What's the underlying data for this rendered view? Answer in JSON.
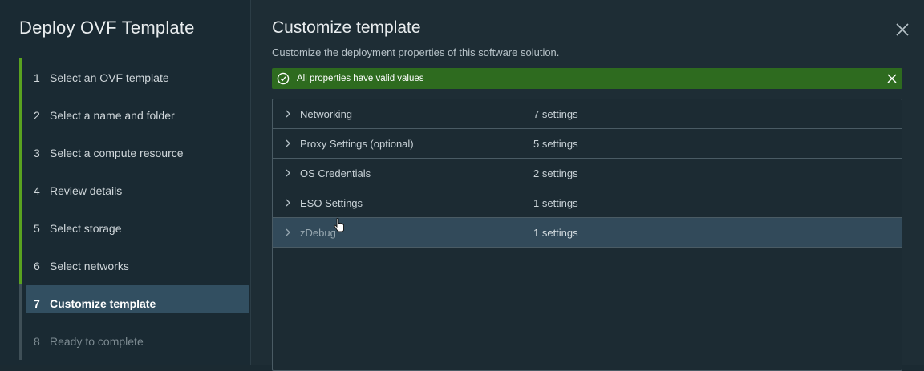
{
  "wizard": {
    "title": "Deploy OVF Template",
    "steps": [
      {
        "num": "1",
        "label": "Select an OVF template"
      },
      {
        "num": "2",
        "label": "Select a name and folder"
      },
      {
        "num": "3",
        "label": "Select a compute resource"
      },
      {
        "num": "4",
        "label": "Review details"
      },
      {
        "num": "5",
        "label": "Select storage"
      },
      {
        "num": "6",
        "label": "Select networks"
      },
      {
        "num": "7",
        "label": "Customize template"
      },
      {
        "num": "8",
        "label": "Ready to complete"
      }
    ],
    "active_step": "7"
  },
  "content": {
    "title": "Customize template",
    "subtitle": "Customize the deployment properties of this software solution.",
    "alert": "All properties have valid values",
    "rows": [
      {
        "name": "Networking",
        "count": "7 settings"
      },
      {
        "name": "Proxy Settings (optional)",
        "count": "5 settings"
      },
      {
        "name": "OS Credentials",
        "count": "2 settings"
      },
      {
        "name": "ESO Settings",
        "count": "1 settings"
      },
      {
        "name": "zDebug",
        "count": "1 settings"
      }
    ]
  },
  "icons": {
    "close": "close-icon",
    "alert_ok": "check-circle-icon",
    "expand": "chevron-right-icon"
  },
  "colors": {
    "accent_green": "#5aa220",
    "alert_bg": "#2e6b1f",
    "active_step_bg": "#324f61",
    "hover_row_bg": "#324a5a"
  }
}
